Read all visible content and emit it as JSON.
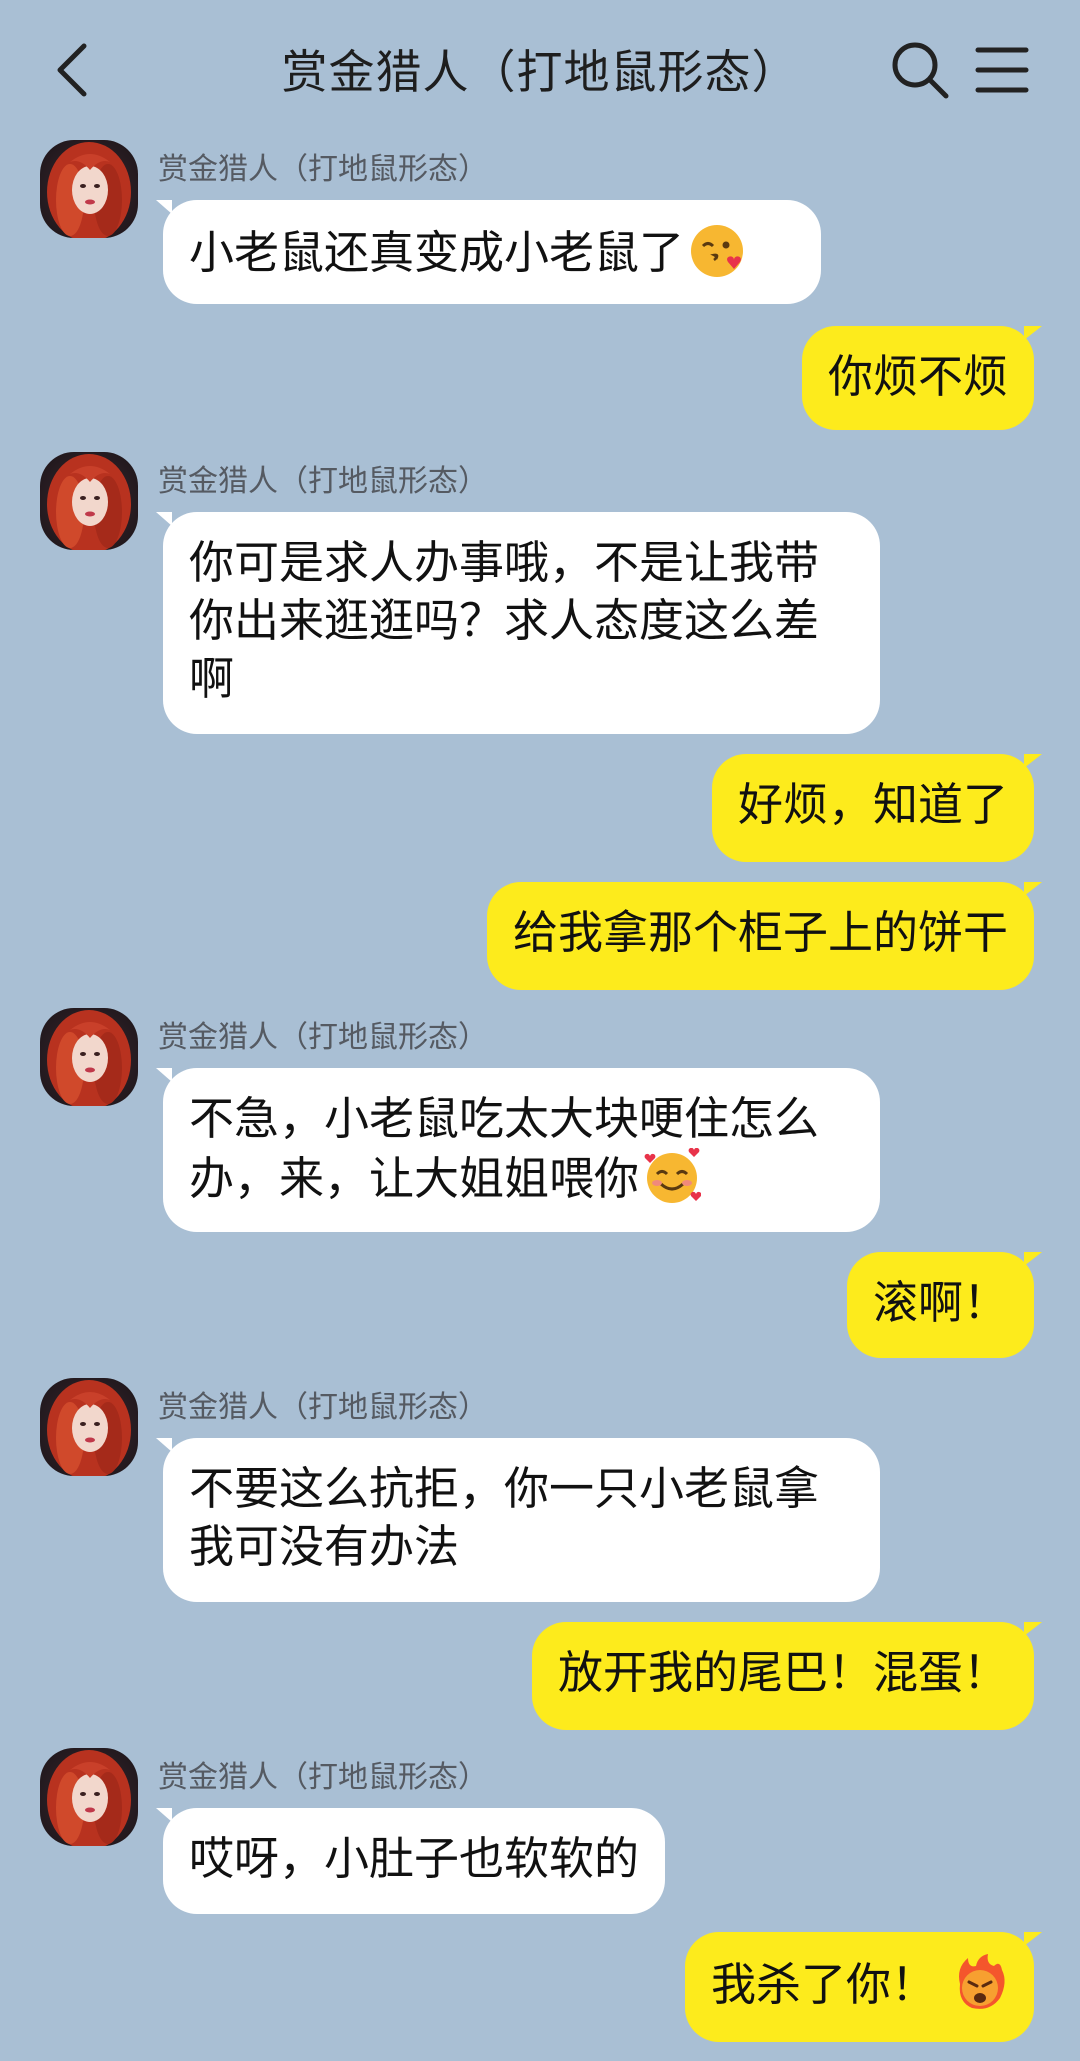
{
  "header": {
    "title": "赏金猎人（打地鼠形态）",
    "back_icon": "chevron-left-icon",
    "search_icon": "search-icon",
    "menu_icon": "menu-icon"
  },
  "sender_name": "赏金猎人（打地鼠形态）",
  "messages": [
    {
      "side": "left",
      "text": "小老鼠还真变成小老鼠了",
      "emoji": "kiss-wink-emoji"
    },
    {
      "side": "right",
      "text": "你烦不烦"
    },
    {
      "side": "left",
      "text": "你可是求人办事哦，不是让我带你出来逛逛吗？求人态度这么差啊"
    },
    {
      "side": "right",
      "text": "好烦，知道了"
    },
    {
      "side": "right",
      "text": "给我拿那个柜子上的饼干"
    },
    {
      "side": "left",
      "text": "不急，小老鼠吃太大块哽住怎么办，来，让大姐姐喂你",
      "emoji": "smiling-hearts-emoji"
    },
    {
      "side": "right",
      "text": "滚啊！"
    },
    {
      "side": "left",
      "text": "不要这么抗拒，你一只小老鼠拿我可没有办法"
    },
    {
      "side": "right",
      "text": "放开我的尾巴！混蛋！"
    },
    {
      "side": "left",
      "text": "哎呀，小肚子也软软的"
    },
    {
      "side": "right",
      "text": "我杀了你！",
      "emoji": "angry-fire-emoji"
    }
  ],
  "colors": {
    "background": "#a9bfd4",
    "incoming_bubble": "#ffffff",
    "outgoing_bubble": "#fdeb1c"
  }
}
